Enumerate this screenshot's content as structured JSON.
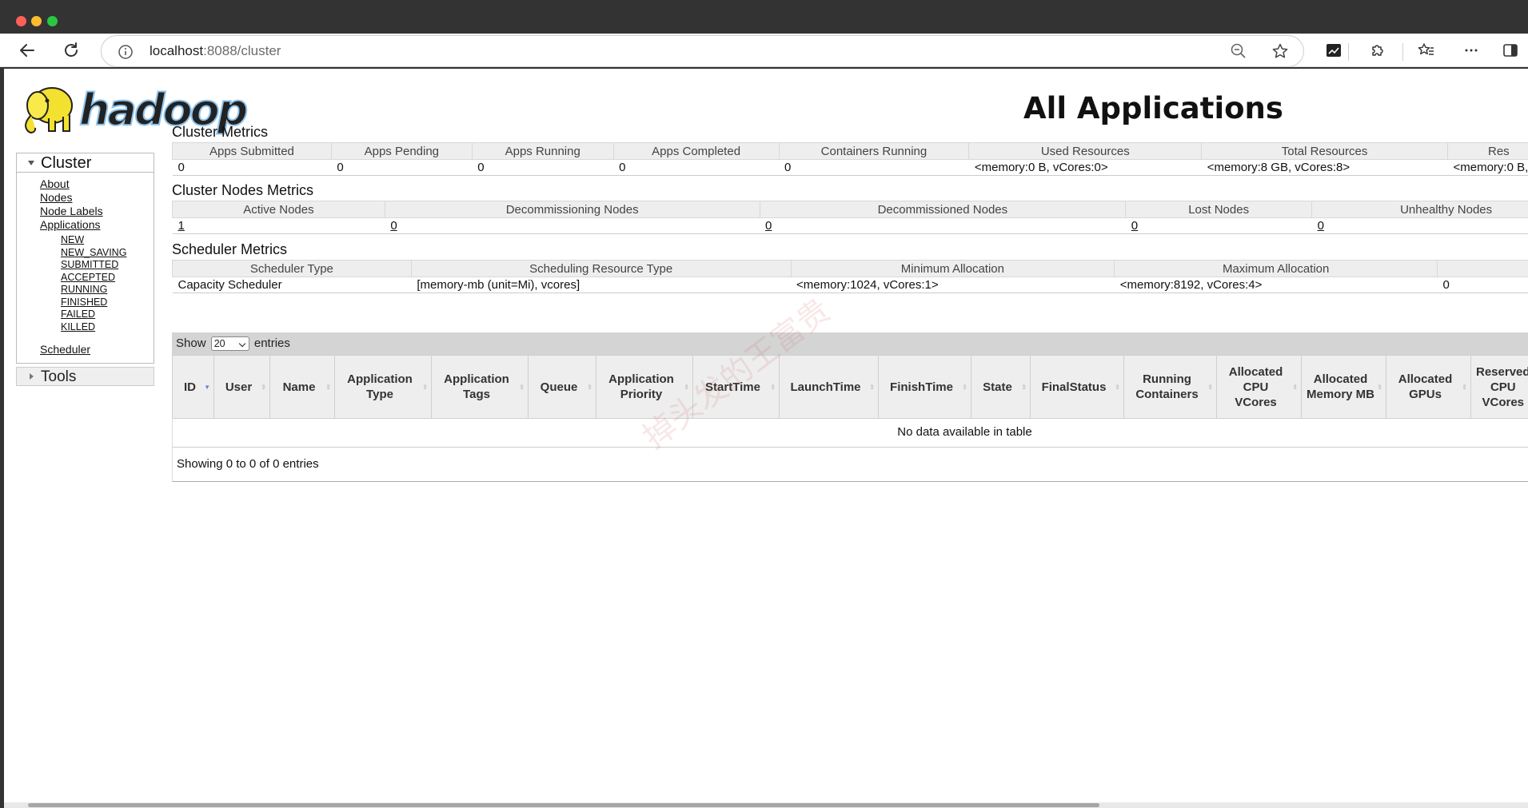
{
  "browser": {
    "url_host": "localhost",
    "url_rest": ":8088/cluster"
  },
  "page": {
    "title": "All Applications",
    "watermark": "掉头发的王富贵"
  },
  "sidebar": {
    "cluster_label": "Cluster",
    "links": [
      "About",
      "Nodes",
      "Node Labels",
      "Applications"
    ],
    "states": [
      "NEW",
      "NEW_SAVING",
      "SUBMITTED",
      "ACCEPTED",
      "RUNNING",
      "FINISHED",
      "FAILED",
      "KILLED"
    ],
    "scheduler_label": "Scheduler",
    "tools_label": "Tools"
  },
  "cluster_metrics": {
    "title": "Cluster Metrics",
    "headers": [
      "Apps Submitted",
      "Apps Pending",
      "Apps Running",
      "Apps Completed",
      "Containers Running",
      "Used Resources",
      "Total Resources",
      "Res"
    ],
    "values": [
      "0",
      "0",
      "0",
      "0",
      "0",
      "<memory:0 B, vCores:0>",
      "<memory:8 GB, vCores:8>",
      "<memory:0 B,"
    ]
  },
  "node_metrics": {
    "title": "Cluster Nodes Metrics",
    "headers": [
      "Active Nodes",
      "Decommissioning Nodes",
      "Decommissioned Nodes",
      "Lost Nodes",
      "Unhealthy Nodes"
    ],
    "values": [
      "1",
      "0",
      "0",
      "0",
      "0"
    ]
  },
  "scheduler_metrics": {
    "title": "Scheduler Metrics",
    "headers": [
      "Scheduler Type",
      "Scheduling Resource Type",
      "Minimum Allocation",
      "Maximum Allocation",
      ""
    ],
    "values": [
      "Capacity Scheduler",
      "[memory-mb (unit=Mi), vcores]",
      "<memory:1024, vCores:1>",
      "<memory:8192, vCores:4>",
      "0"
    ]
  },
  "apps_table": {
    "show_label": "Show",
    "page_size": "20",
    "entries_label": "entries",
    "columns": [
      {
        "label": "ID",
        "w": 52
      },
      {
        "label": "User",
        "w": 70
      },
      {
        "label": "Name",
        "w": 81
      },
      {
        "label": "Application Type",
        "w": 121
      },
      {
        "label": "Application Tags",
        "w": 121
      },
      {
        "label": "Queue",
        "w": 85
      },
      {
        "label": "Application Priority",
        "w": 121
      },
      {
        "label": "StartTime",
        "w": 108
      },
      {
        "label": "LaunchTime",
        "w": 124
      },
      {
        "label": "FinishTime",
        "w": 116
      },
      {
        "label": "State",
        "w": 74
      },
      {
        "label": "FinalStatus",
        "w": 117
      },
      {
        "label": "Running Containers",
        "w": 116
      },
      {
        "label": "Allocated CPU VCores",
        "w": 106
      },
      {
        "label": "Allocated Memory MB",
        "w": 106
      },
      {
        "label": "Allocated GPUs",
        "w": 106
      },
      {
        "label": "Reserved CPU VCores",
        "w": 82
      }
    ],
    "empty_text": "No data available in table",
    "info_text": "Showing 0 to 0 of 0 entries"
  }
}
